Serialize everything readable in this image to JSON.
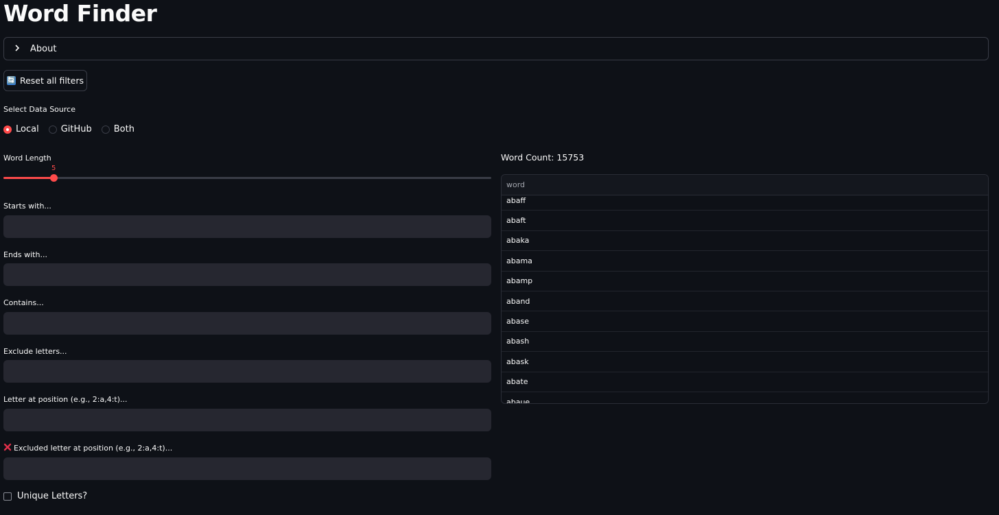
{
  "app": {
    "title": "Word Finder"
  },
  "about": {
    "label": "About"
  },
  "reset": {
    "icon": "🔄",
    "label": "Reset all filters"
  },
  "data_source": {
    "label": "Select Data Source",
    "options": [
      "Local",
      "GitHub",
      "Both"
    ],
    "selected": "Local"
  },
  "word_length": {
    "label": "Word Length",
    "value": "5"
  },
  "filters": {
    "starts_with": {
      "label": "Starts with...",
      "value": ""
    },
    "ends_with": {
      "label": "Ends with...",
      "value": ""
    },
    "contains": {
      "label": "Contains...",
      "value": ""
    },
    "exclude": {
      "label": "Exclude letters...",
      "value": ""
    },
    "letter_pos": {
      "label": "Letter at position (e.g., 2:a,4:t)...",
      "value": ""
    },
    "excluded_pos": {
      "label": "Excluded letter at position (e.g., 2:a,4:t)...",
      "value": ""
    }
  },
  "unique": {
    "label": "Unique Letters?",
    "checked": false
  },
  "results": {
    "count_label": "Word Count: 15753",
    "column": "word",
    "words": [
      "abaff",
      "abaft",
      "abaka",
      "abama",
      "abamp",
      "aband",
      "abase",
      "abash",
      "abask",
      "abate",
      "abaue"
    ]
  },
  "colors": {
    "accent": "#ff4b4b",
    "background": "#0e1117",
    "input_bg": "#262730"
  }
}
